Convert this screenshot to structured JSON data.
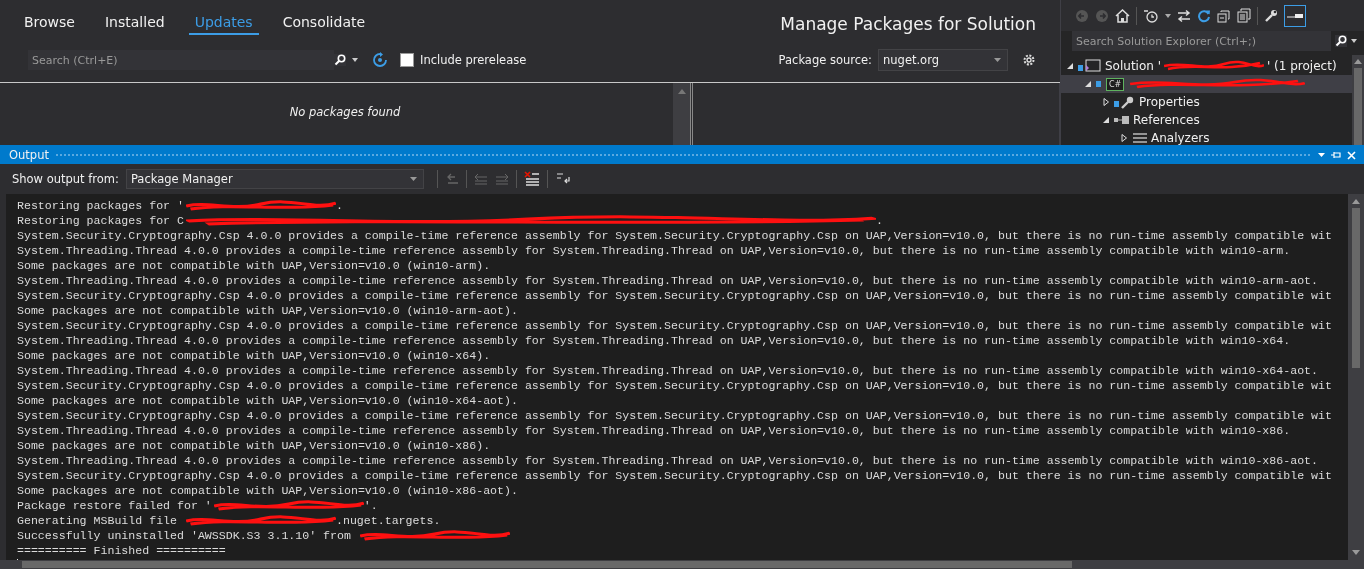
{
  "nuget": {
    "tabs": [
      {
        "label": "Browse",
        "selected": false
      },
      {
        "label": "Installed",
        "selected": false
      },
      {
        "label": "Updates",
        "selected": true
      },
      {
        "label": "Consolidate",
        "selected": false
      }
    ],
    "title": "Manage Packages for Solution",
    "search": {
      "placeholder": "Search (Ctrl+E)"
    },
    "include_prerelease": {
      "label": "Include prerelease",
      "checked": false
    },
    "package_source": {
      "label": "Package source:",
      "value": "nuget.org"
    },
    "empty_message": "No packages found"
  },
  "solution_explorer": {
    "search": {
      "placeholder": "Search Solution Explorer (Ctrl+;)"
    },
    "tree": [
      {
        "kind": "solution",
        "label": "Solution '",
        "tail": "' (1 project)",
        "redacted": true,
        "expanded": true,
        "children": [
          {
            "kind": "project",
            "icon_text": "C#",
            "redacted": true,
            "expanded": true,
            "children": [
              {
                "kind": "properties",
                "label": "Properties",
                "expanded": false
              },
              {
                "kind": "references",
                "label": "References",
                "expanded": true,
                "children": [
                  {
                    "kind": "analyzers",
                    "label": "Analyzers",
                    "expanded": false
                  }
                ]
              }
            ]
          }
        ]
      }
    ]
  },
  "output": {
    "title": "Output",
    "show_from_label": "Show output from:",
    "source": "Package Manager",
    "lines": [
      {
        "text": "Restoring packages for '",
        "redacted": true,
        "tail": "."
      },
      {
        "text": "Restoring packages for C",
        "redacted": true,
        "tail": "."
      },
      {
        "text": "System.Security.Cryptography.Csp 4.0.0 provides a compile-time reference assembly for System.Security.Cryptography.Csp on UAP,Version=v10.0, but there is no run-time assembly compatible wit"
      },
      {
        "text": "System.Threading.Thread 4.0.0 provides a compile-time reference assembly for System.Threading.Thread on UAP,Version=v10.0, but there is no run-time assembly compatible with win10-arm."
      },
      {
        "text": "Some packages are not compatible with UAP,Version=v10.0 (win10-arm)."
      },
      {
        "text": "System.Threading.Thread 4.0.0 provides a compile-time reference assembly for System.Threading.Thread on UAP,Version=v10.0, but there is no run-time assembly compatible with win10-arm-aot."
      },
      {
        "text": "System.Security.Cryptography.Csp 4.0.0 provides a compile-time reference assembly for System.Security.Cryptography.Csp on UAP,Version=v10.0, but there is no run-time assembly compatible wit"
      },
      {
        "text": "Some packages are not compatible with UAP,Version=v10.0 (win10-arm-aot)."
      },
      {
        "text": "System.Security.Cryptography.Csp 4.0.0 provides a compile-time reference assembly for System.Security.Cryptography.Csp on UAP,Version=v10.0, but there is no run-time assembly compatible wit"
      },
      {
        "text": "System.Threading.Thread 4.0.0 provides a compile-time reference assembly for System.Threading.Thread on UAP,Version=v10.0, but there is no run-time assembly compatible with win10-x64."
      },
      {
        "text": "Some packages are not compatible with UAP,Version=v10.0 (win10-x64)."
      },
      {
        "text": "System.Threading.Thread 4.0.0 provides a compile-time reference assembly for System.Threading.Thread on UAP,Version=v10.0, but there is no run-time assembly compatible with win10-x64-aot."
      },
      {
        "text": "System.Security.Cryptography.Csp 4.0.0 provides a compile-time reference assembly for System.Security.Cryptography.Csp on UAP,Version=v10.0, but there is no run-time assembly compatible wit"
      },
      {
        "text": "Some packages are not compatible with UAP,Version=v10.0 (win10-x64-aot)."
      },
      {
        "text": "System.Security.Cryptography.Csp 4.0.0 provides a compile-time reference assembly for System.Security.Cryptography.Csp on UAP,Version=v10.0, but there is no run-time assembly compatible wit"
      },
      {
        "text": "System.Threading.Thread 4.0.0 provides a compile-time reference assembly for System.Threading.Thread on UAP,Version=v10.0, but there is no run-time assembly compatible with win10-x86."
      },
      {
        "text": "Some packages are not compatible with UAP,Version=v10.0 (win10-x86)."
      },
      {
        "text": "System.Threading.Thread 4.0.0 provides a compile-time reference assembly for System.Threading.Thread on UAP,Version=v10.0, but there is no run-time assembly compatible with win10-x86-aot."
      },
      {
        "text": "System.Security.Cryptography.Csp 4.0.0 provides a compile-time reference assembly for System.Security.Cryptography.Csp on UAP,Version=v10.0, but there is no run-time assembly compatible wit"
      },
      {
        "text": "Some packages are not compatible with UAP,Version=v10.0 (win10-x86-aot)."
      },
      {
        "text": "Package restore failed for '",
        "redacted": true,
        "tail": "'."
      },
      {
        "text": "Generating MSBuild file ",
        "redacted": true,
        "tail": ".nuget.targets."
      },
      {
        "text": "Successfully uninstalled 'AWSSDK.S3 3.1.10' from ",
        "redacted": true
      },
      {
        "text": "========== Finished =========="
      }
    ]
  }
}
